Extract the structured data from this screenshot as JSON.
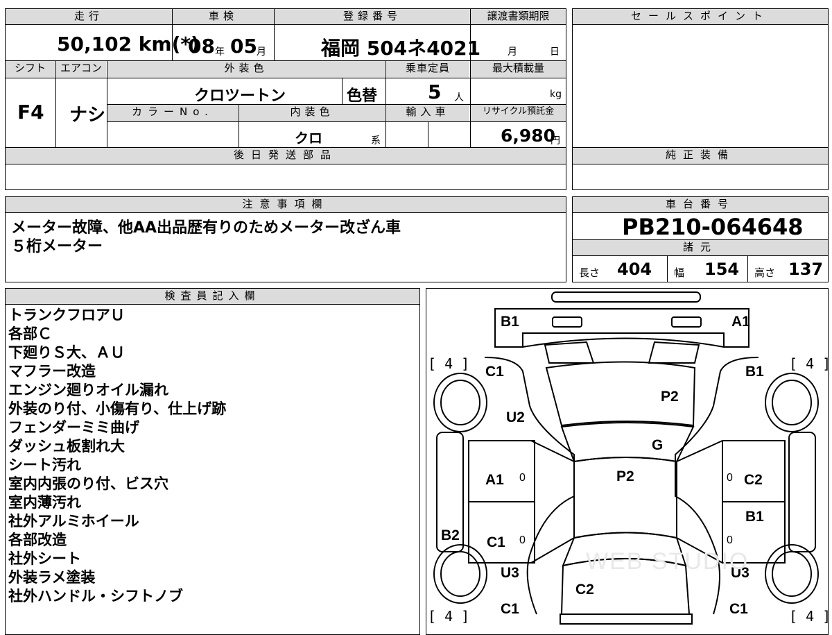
{
  "top_table": {
    "headers": {
      "mileage": "走行",
      "inspection": "車検",
      "registration": "登録番号",
      "transfer_deadline": "譲渡書類期限",
      "sales_point": "セールスポイント",
      "shift": "シフト",
      "aircon": "エアコン",
      "exterior_color": "外装色",
      "capacity": "乗車定員",
      "max_load": "最大積載量",
      "color_no": "カラーNo.",
      "interior_color": "内装色",
      "import": "輸入車",
      "recycle_fee": "リサイクル預託金",
      "later_parts": "後日発送部品",
      "genuine_equipment": "純正装備"
    },
    "values": {
      "mileage": "50,102 km(*)",
      "inspection_year": "08",
      "year_unit": "年",
      "inspection_month": "05",
      "month_unit": "月",
      "registration": "福岡 504ネ4021",
      "deadline_month_unit": "月",
      "deadline_day_unit": "日",
      "shift": "F4",
      "aircon": "ナシ",
      "exterior_color": "クロツートン",
      "color_change": "色替",
      "capacity": "5",
      "capacity_unit": "人",
      "max_load_unit": "kg",
      "interior_color": "クロ",
      "interior_suffix": "系",
      "recycle_fee": "6,980",
      "yen_unit": "円"
    }
  },
  "notes": {
    "header": "注意事項欄",
    "lines": [
      "メーター故障、他AA出品歴有りのためメーター改ざん車",
      "５桁メーター"
    ]
  },
  "chassis": {
    "header": "車台番号",
    "value": "PB210-064648",
    "specs_header": "諸元",
    "length_label": "長さ",
    "length": "404",
    "width_label": "幅",
    "width": "154",
    "height_label": "高さ",
    "height": "137"
  },
  "inspector": {
    "header": "検査員記入欄",
    "lines": [
      "トランクフロアＵ",
      "各部Ｃ",
      "下廻りＳ大、ＡＵ",
      "マフラー改造",
      "エンジン廻りオイル漏れ",
      "外装のり付、小傷有り、仕上げ跡",
      "フェンダーミミ曲げ",
      "ダッシュ板割れ大",
      "シート汚れ",
      "室内内張のり付、ビス穴",
      "室内薄汚れ",
      "社外アルミホイール",
      "各部改造",
      "社外シート",
      "外装ラメ塗装",
      "社外ハンドル・シフトノブ"
    ]
  },
  "diagram": {
    "labels": {
      "rear_left": "B1",
      "rear_right": "A1",
      "tire_tl": "[ 4 ]",
      "tire_tr": "[ 4 ]",
      "tire_bl": "[ 4 ]",
      "tire_br": "[ 4 ]",
      "rl_quarter": "C1",
      "rr_quarter": "B1",
      "trunk": "P2",
      "rl_u": "U2",
      "rear_glass": "G",
      "roof": "P2",
      "left_rear_door": "A1",
      "right_rear_door": "C2",
      "right_front_door": "B1",
      "left_sill": "B2",
      "left_front_door": "C1",
      "fl_u": "U3",
      "fr_u": "U3",
      "hood": "C2",
      "fl_fender": "C1",
      "fr_fender": "C1",
      "zero": "0",
      "watermark": "WEB STUDIO"
    }
  }
}
